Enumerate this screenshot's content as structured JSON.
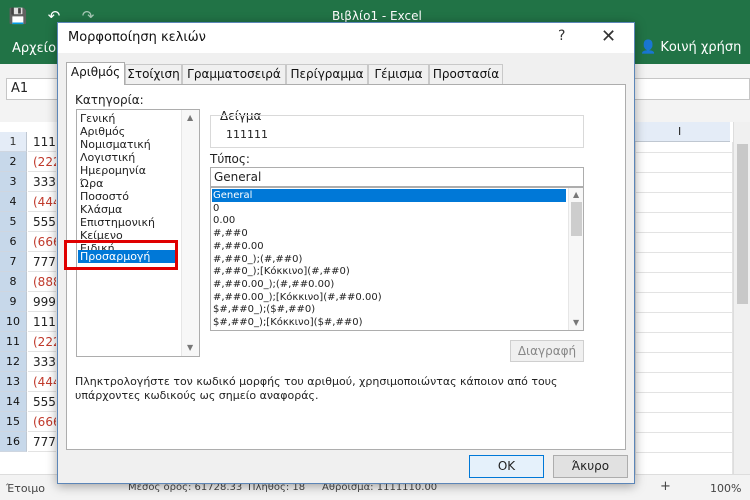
{
  "titlebar": {
    "title": "Βιβλίο1  -  Excel"
  },
  "ribbon": {
    "file_tab": "Αρχείο",
    "share": "Κοινή χρήση"
  },
  "formula_bar": {
    "name_box": "A1"
  },
  "sheet": {
    "column_header": "I",
    "rows": [
      {
        "n": "1",
        "v": "111",
        "neg": false
      },
      {
        "n": "2",
        "v": "(222",
        "neg": true
      },
      {
        "n": "3",
        "v": "333",
        "neg": false
      },
      {
        "n": "4",
        "v": "(444",
        "neg": true
      },
      {
        "n": "5",
        "v": "555",
        "neg": false
      },
      {
        "n": "6",
        "v": "(666",
        "neg": true
      },
      {
        "n": "7",
        "v": "777",
        "neg": false
      },
      {
        "n": "8",
        "v": "(888",
        "neg": true
      },
      {
        "n": "9",
        "v": "999",
        "neg": false
      },
      {
        "n": "10",
        "v": "111",
        "neg": false
      },
      {
        "n": "11",
        "v": "(222",
        "neg": true
      },
      {
        "n": "12",
        "v": "333",
        "neg": false
      },
      {
        "n": "13",
        "v": "(444",
        "neg": true
      },
      {
        "n": "14",
        "v": "555",
        "neg": false
      },
      {
        "n": "15",
        "v": "(666",
        "neg": true
      },
      {
        "n": "16",
        "v": "777",
        "neg": false
      }
    ]
  },
  "statusbar": {
    "ready": "Έτοιμο",
    "average": "Μέσος όρος: 61728.33",
    "count": "Πλήθος: 18",
    "sum": "Άθροισμα: 1111110.00",
    "zoom": "100%"
  },
  "dialog": {
    "title": "Μορφοποίηση κελιών",
    "help": "?",
    "close": "✕",
    "tabs": [
      "Αριθμός",
      "Στοίχιση",
      "Γραμματοσειρά",
      "Περίγραμμα",
      "Γέμισμα",
      "Προστασία"
    ],
    "category_label": "Κατηγορία:",
    "categories": [
      "Γενική",
      "Αριθμός",
      "Νομισματική",
      "Λογιστική",
      "Ημερομηνία",
      "Ώρα",
      "Ποσοστό",
      "Κλάσμα",
      "Επιστημονική",
      "Κείμενο",
      "Ειδική",
      "Προσαρμογή"
    ],
    "selected_category": "Προσαρμογή",
    "sample_label": "Δείγμα",
    "sample_value": "111111",
    "type_label": "Τύπος:",
    "type_value": "General",
    "formats": [
      "General",
      "0",
      "0.00",
      "#,##0",
      "#,##0.00",
      "#,##0_);(#,##0)",
      "#,##0_);[Κόκκινο](#,##0)",
      "#,##0.00_);(#,##0.00)",
      "#,##0.00_);[Κόκκινο](#,##0.00)",
      "$#,##0_);($#,##0)",
      "$#,##0_);[Κόκκινο]($#,##0)"
    ],
    "delete_button": "Διαγραφή",
    "description": "Πληκτρολογήστε τον κωδικό μορφής του αριθμού, χρησιμοποιώντας κάποιον από τους υπάρχοντες κωδικούς ως σημείο αναφοράς.",
    "ok": "OK",
    "cancel": "Άκυρο"
  },
  "colors": {
    "excel_green": "#217346",
    "selection_blue": "#0078d7",
    "highlight_red": "#e00000",
    "negative_red": "#c0392b"
  }
}
